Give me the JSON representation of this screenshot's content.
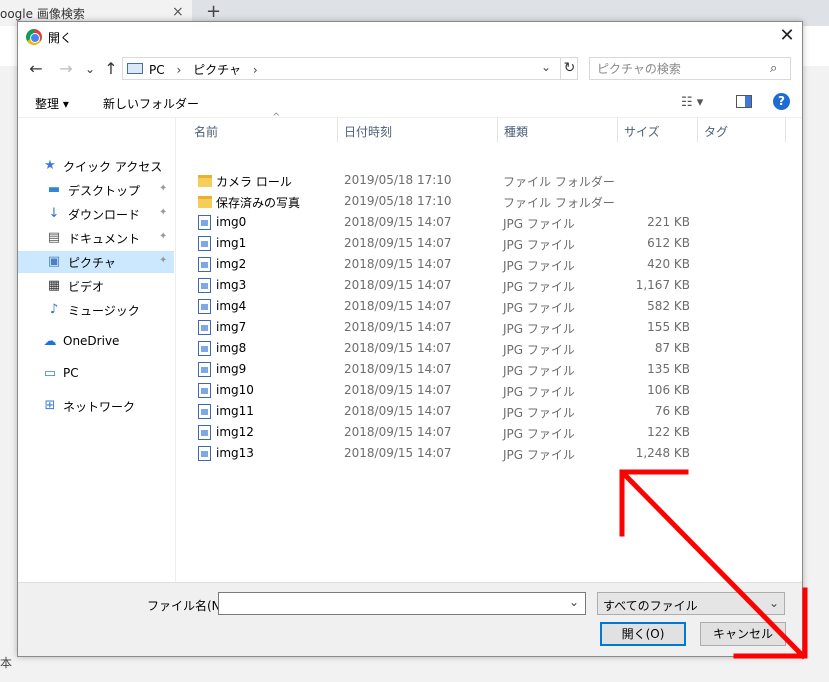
{
  "browser": {
    "tab_title": "oogle 画像検索",
    "tab_close": "×",
    "new_tab": "+",
    "bottom_text": "本"
  },
  "dialog": {
    "title": "開く",
    "close": "✕",
    "nav": {
      "back": "←",
      "forward": "→",
      "recent": "⌄",
      "up": "↑"
    },
    "address": {
      "crumbs": [
        "PC",
        "ピクチャ"
      ],
      "separator": "›",
      "dropdown": "⌄",
      "refresh": "↻"
    },
    "search": {
      "placeholder": "ピクチャの検索",
      "icon": "⌕"
    },
    "toolbar": {
      "organize": "整理 ▾",
      "new_folder": "新しいフォルダー",
      "view": "☷ ▾",
      "help": "?"
    },
    "nav_pane": [
      {
        "label": "クイック アクセス",
        "icon": "star-icon",
        "glyph": "★",
        "color": "#3d7fd4",
        "top": true,
        "pin": false,
        "selected": false
      },
      {
        "label": "デスクトップ",
        "icon": "desktop-icon",
        "glyph": "▬",
        "color": "#2f86d6",
        "top": false,
        "pin": true,
        "selected": false
      },
      {
        "label": "ダウンロード",
        "icon": "download-icon",
        "glyph": "↓",
        "color": "#2a6fd1",
        "top": false,
        "pin": true,
        "selected": false
      },
      {
        "label": "ドキュメント",
        "icon": "document-icon",
        "glyph": "▤",
        "color": "#555555",
        "top": false,
        "pin": true,
        "selected": false
      },
      {
        "label": "ピクチャ",
        "icon": "picture-icon",
        "glyph": "▣",
        "color": "#4a7fc0",
        "top": false,
        "pin": true,
        "selected": true
      },
      {
        "label": "ビデオ",
        "icon": "video-icon",
        "glyph": "▦",
        "color": "#333333",
        "top": false,
        "pin": false,
        "selected": false
      },
      {
        "label": "ミュージック",
        "icon": "music-icon",
        "glyph": "♪",
        "color": "#2f6fd6",
        "top": false,
        "pin": false,
        "selected": false
      },
      {
        "label": "OneDrive",
        "icon": "cloud-icon",
        "glyph": "☁",
        "color": "#1e73d8",
        "top": true,
        "pin": false,
        "selected": false
      },
      {
        "label": "PC",
        "icon": "pc-icon",
        "glyph": "▭",
        "color": "#3a7bd0",
        "top": true,
        "pin": false,
        "selected": false
      },
      {
        "label": "ネットワーク",
        "icon": "network-icon",
        "glyph": "⊞",
        "color": "#3a7bd0",
        "top": true,
        "pin": false,
        "selected": false
      }
    ],
    "pin_glyph": "📌",
    "columns": [
      "名前",
      "日付時刻",
      "種類",
      "サイズ",
      "タグ"
    ],
    "sort_caret": "^",
    "files": [
      {
        "name": "カメラ ロール",
        "date": "2019/05/18 17:10",
        "type": "ファイル フォルダー",
        "size": "",
        "kind": "folder"
      },
      {
        "name": "保存済みの写真",
        "date": "2019/05/18 17:10",
        "type": "ファイル フォルダー",
        "size": "",
        "kind": "folder"
      },
      {
        "name": "img0",
        "date": "2018/09/15 14:07",
        "type": "JPG ファイル",
        "size": "221 KB",
        "kind": "image"
      },
      {
        "name": "img1",
        "date": "2018/09/15 14:07",
        "type": "JPG ファイル",
        "size": "612 KB",
        "kind": "image"
      },
      {
        "name": "img2",
        "date": "2018/09/15 14:07",
        "type": "JPG ファイル",
        "size": "420 KB",
        "kind": "image"
      },
      {
        "name": "img3",
        "date": "2018/09/15 14:07",
        "type": "JPG ファイル",
        "size": "1,167 KB",
        "kind": "image"
      },
      {
        "name": "img4",
        "date": "2018/09/15 14:07",
        "type": "JPG ファイル",
        "size": "582 KB",
        "kind": "image"
      },
      {
        "name": "img7",
        "date": "2018/09/15 14:07",
        "type": "JPG ファイル",
        "size": "155 KB",
        "kind": "image"
      },
      {
        "name": "img8",
        "date": "2018/09/15 14:07",
        "type": "JPG ファイル",
        "size": "87 KB",
        "kind": "image"
      },
      {
        "name": "img9",
        "date": "2018/09/15 14:07",
        "type": "JPG ファイル",
        "size": "135 KB",
        "kind": "image"
      },
      {
        "name": "img10",
        "date": "2018/09/15 14:07",
        "type": "JPG ファイル",
        "size": "106 KB",
        "kind": "image"
      },
      {
        "name": "img11",
        "date": "2018/09/15 14:07",
        "type": "JPG ファイル",
        "size": "76 KB",
        "kind": "image"
      },
      {
        "name": "img12",
        "date": "2018/09/15 14:07",
        "type": "JPG ファイル",
        "size": "122 KB",
        "kind": "image"
      },
      {
        "name": "img13",
        "date": "2018/09/15 14:07",
        "type": "JPG ファイル",
        "size": "1,248 KB",
        "kind": "image"
      }
    ],
    "footer": {
      "filename_label": "ファイル名(N):",
      "filename_value": "",
      "filename_dropdown": "⌄",
      "filetype": "すべてのファイル",
      "filetype_dropdown": "⌄",
      "open_button": "開く(O)",
      "cancel_button": "キャンセル"
    },
    "accent_color": "#0078d7",
    "annotation_color": "#ff0000"
  }
}
